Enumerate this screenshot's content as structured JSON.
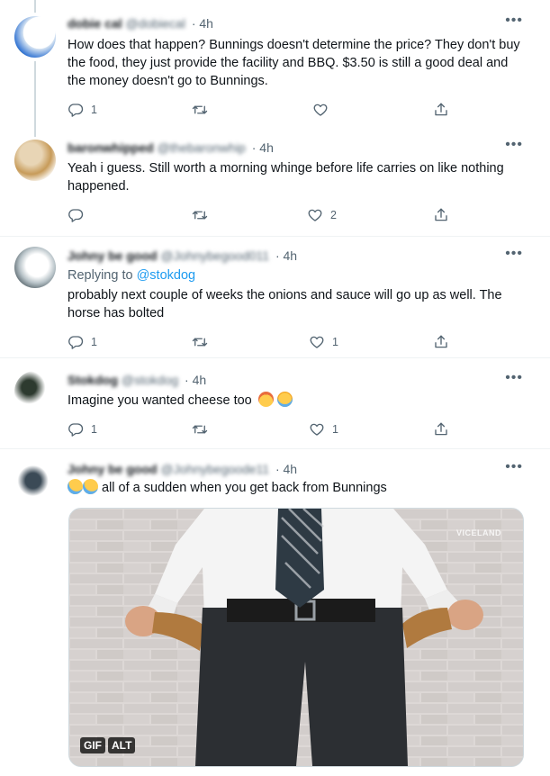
{
  "tweets": [
    {
      "name": "dobie cal",
      "handle": "@dobiecal",
      "time": "· 4h",
      "text": "How does that happen? Bunnings doesn't determine the price? They don't buy the food, they just provide the facility and BBQ. $3.50 is still a good deal and the money doesn't go to Bunnings.",
      "reply_count": "1",
      "retweet_count": "",
      "like_count": ""
    },
    {
      "name": "baronwhipped",
      "handle": "@thebaronwhip",
      "time": "· 4h",
      "text": "Yeah i guess. Still worth a morning whinge before life carries on like nothing happened.",
      "reply_count": "",
      "retweet_count": "",
      "like_count": "2"
    },
    {
      "name": "Johny be good",
      "handle": "@Johnybegood011",
      "time": "· 4h",
      "reply_prefix": "Replying to ",
      "reply_handle": "@stokdog",
      "text": "probably next couple of weeks the onions and sauce will go up as well. The horse has bolted",
      "reply_count": "1",
      "retweet_count": "",
      "like_count": "1"
    },
    {
      "name": "Stokdog",
      "handle": "@stokdog",
      "time": "· 4h",
      "text": "Imagine you wanted cheese too",
      "reply_count": "1",
      "retweet_count": "",
      "like_count": "1"
    },
    {
      "name": "Johny be good",
      "handle": "@Johnybegoode11",
      "time": "· 4h",
      "text": "all of a sudden when you get back from Bunnings",
      "media_watermark": "VICELAND",
      "gif_label": "GIF",
      "alt_label": "ALT"
    }
  ],
  "colors": {
    "accent": "#1d9bf0",
    "muted": "#536471",
    "divider": "#eff3f4"
  },
  "icons": {
    "more": "more-dots-icon",
    "reply": "reply-icon",
    "retweet": "retweet-icon",
    "like": "heart-icon",
    "share": "share-icon"
  }
}
